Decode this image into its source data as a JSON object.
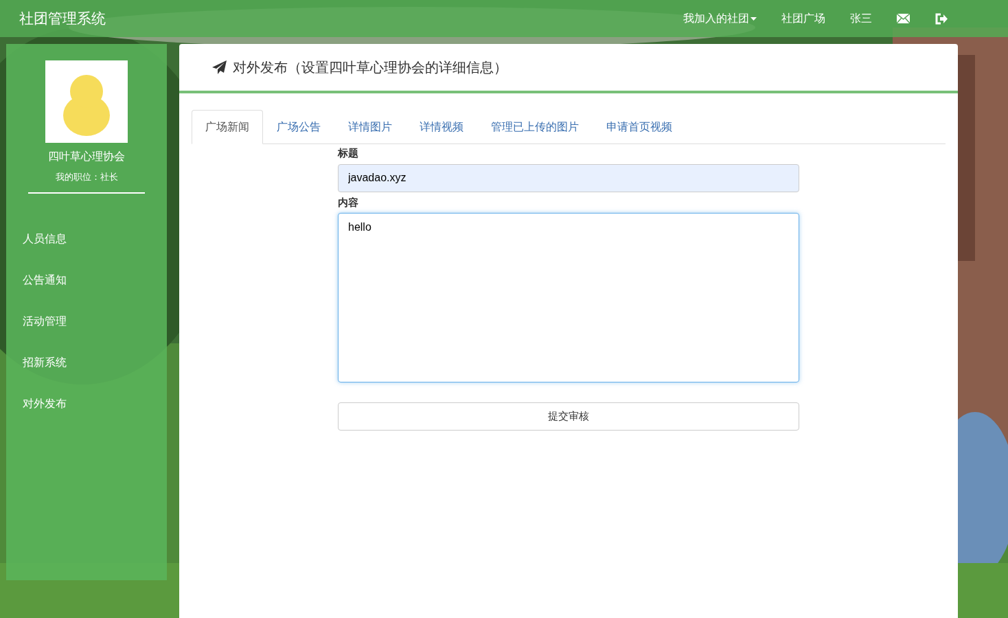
{
  "navbar": {
    "brand": "社团管理系统",
    "links": [
      {
        "kind": "dropdown",
        "label": "我加入的社团"
      },
      {
        "kind": "text",
        "label": "社团广场"
      },
      {
        "kind": "text",
        "label": "张三"
      },
      {
        "kind": "mail"
      },
      {
        "kind": "logout"
      }
    ]
  },
  "sidebar": {
    "club": "四叶草心理协会",
    "position": "我的职位：社长",
    "items": [
      {
        "label": "人员信息"
      },
      {
        "label": "公告通知"
      },
      {
        "label": "活动管理"
      },
      {
        "label": "招新系统"
      },
      {
        "label": "对外发布"
      }
    ]
  },
  "panel": {
    "title": "对外发布（设置四叶草心理协会的详细信息）",
    "tabs": [
      {
        "label": "广场新闻",
        "selected": true
      },
      {
        "label": "广场公告",
        "selected": false
      },
      {
        "label": "详情图片",
        "selected": false
      },
      {
        "label": "详情视频",
        "selected": false
      },
      {
        "label": "管理已上传的图片",
        "selected": false
      },
      {
        "label": "申请首页视频",
        "selected": false
      }
    ],
    "form": {
      "title_label": "标题",
      "title_value": "javadao.xyz",
      "content_label": "内容",
      "content_value": "hello",
      "submit": "提交审核"
    }
  }
}
